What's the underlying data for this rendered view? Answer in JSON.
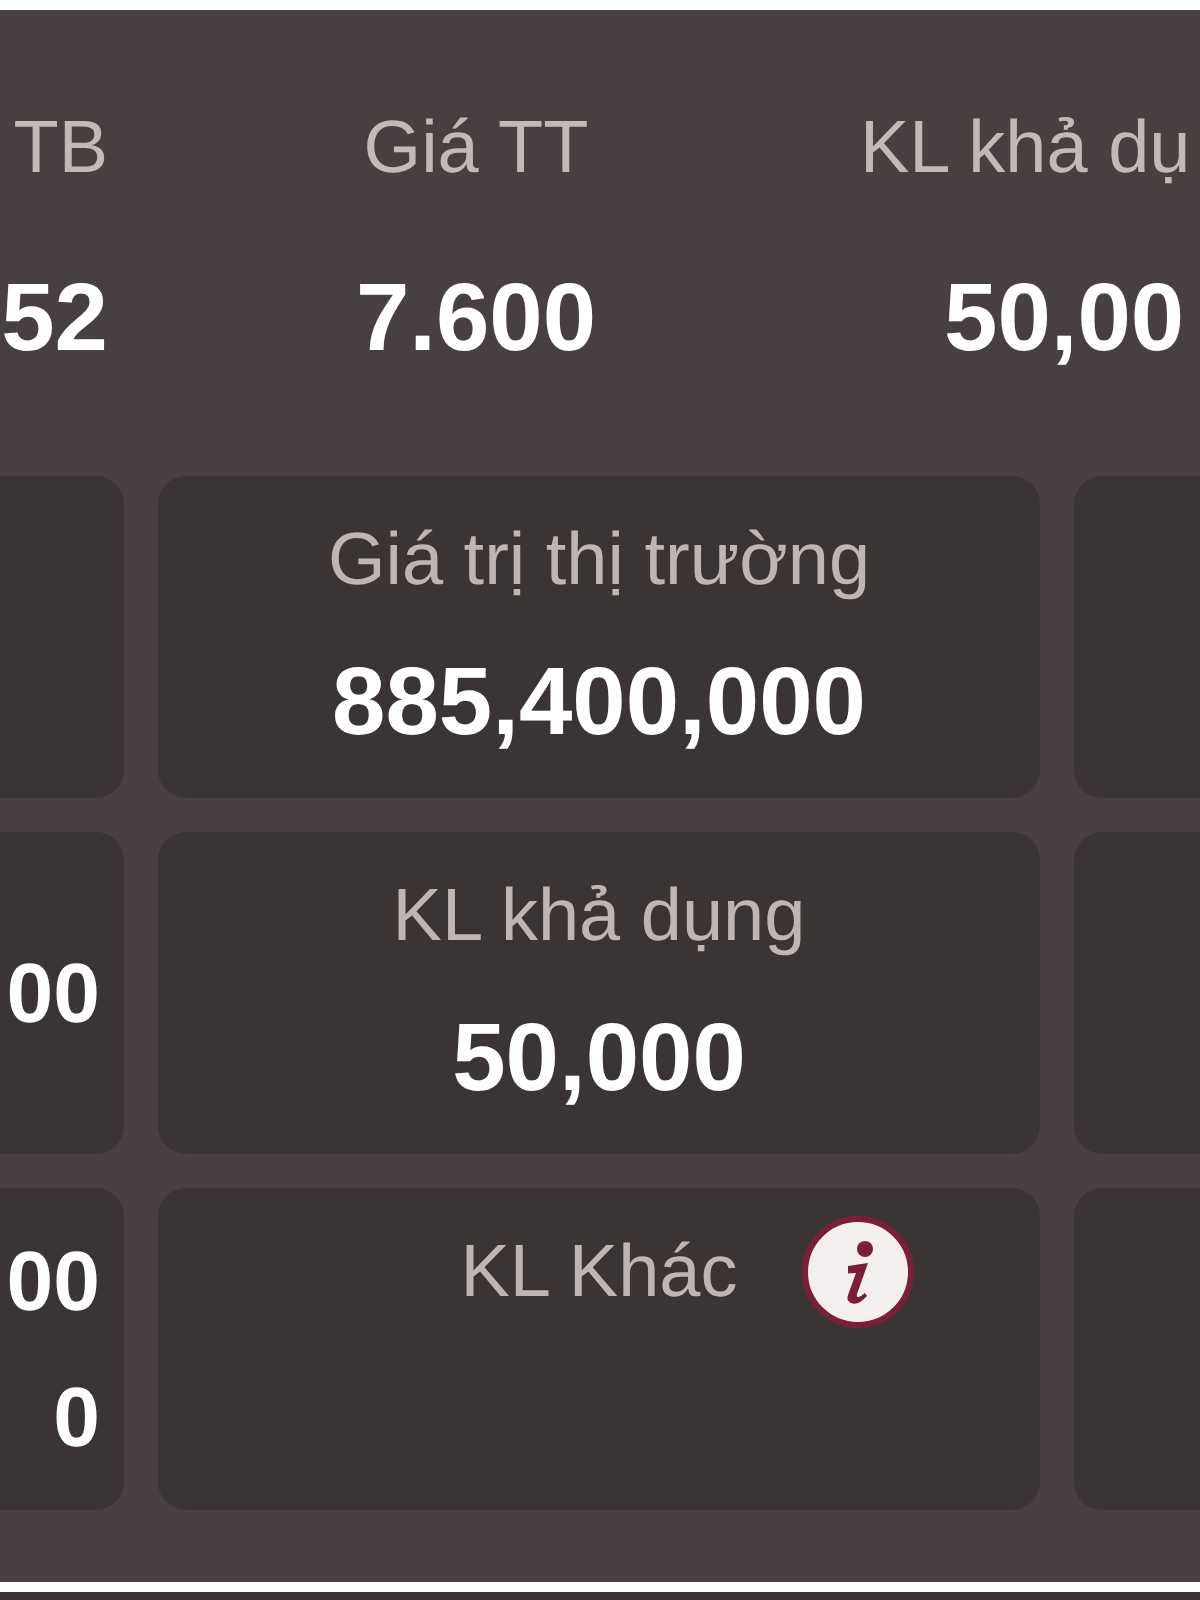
{
  "summary": [
    {
      "label": "TB",
      "value": "52"
    },
    {
      "label": "Giá TT",
      "value": "7.600"
    },
    {
      "label": "KL khả dụ",
      "value": "50,00"
    }
  ],
  "card_rows": [
    {
      "middle": {
        "label": "Giá trị thị trường",
        "value": "885,400,000",
        "info": false
      }
    },
    {
      "left": {
        "values": [
          "00"
        ]
      },
      "middle": {
        "label": "KL khả dụng",
        "value": "50,000",
        "info": false
      }
    },
    {
      "left": {
        "values": [
          "00",
          "0"
        ]
      },
      "middle": {
        "label": "KL Khác",
        "info": true
      }
    }
  ]
}
